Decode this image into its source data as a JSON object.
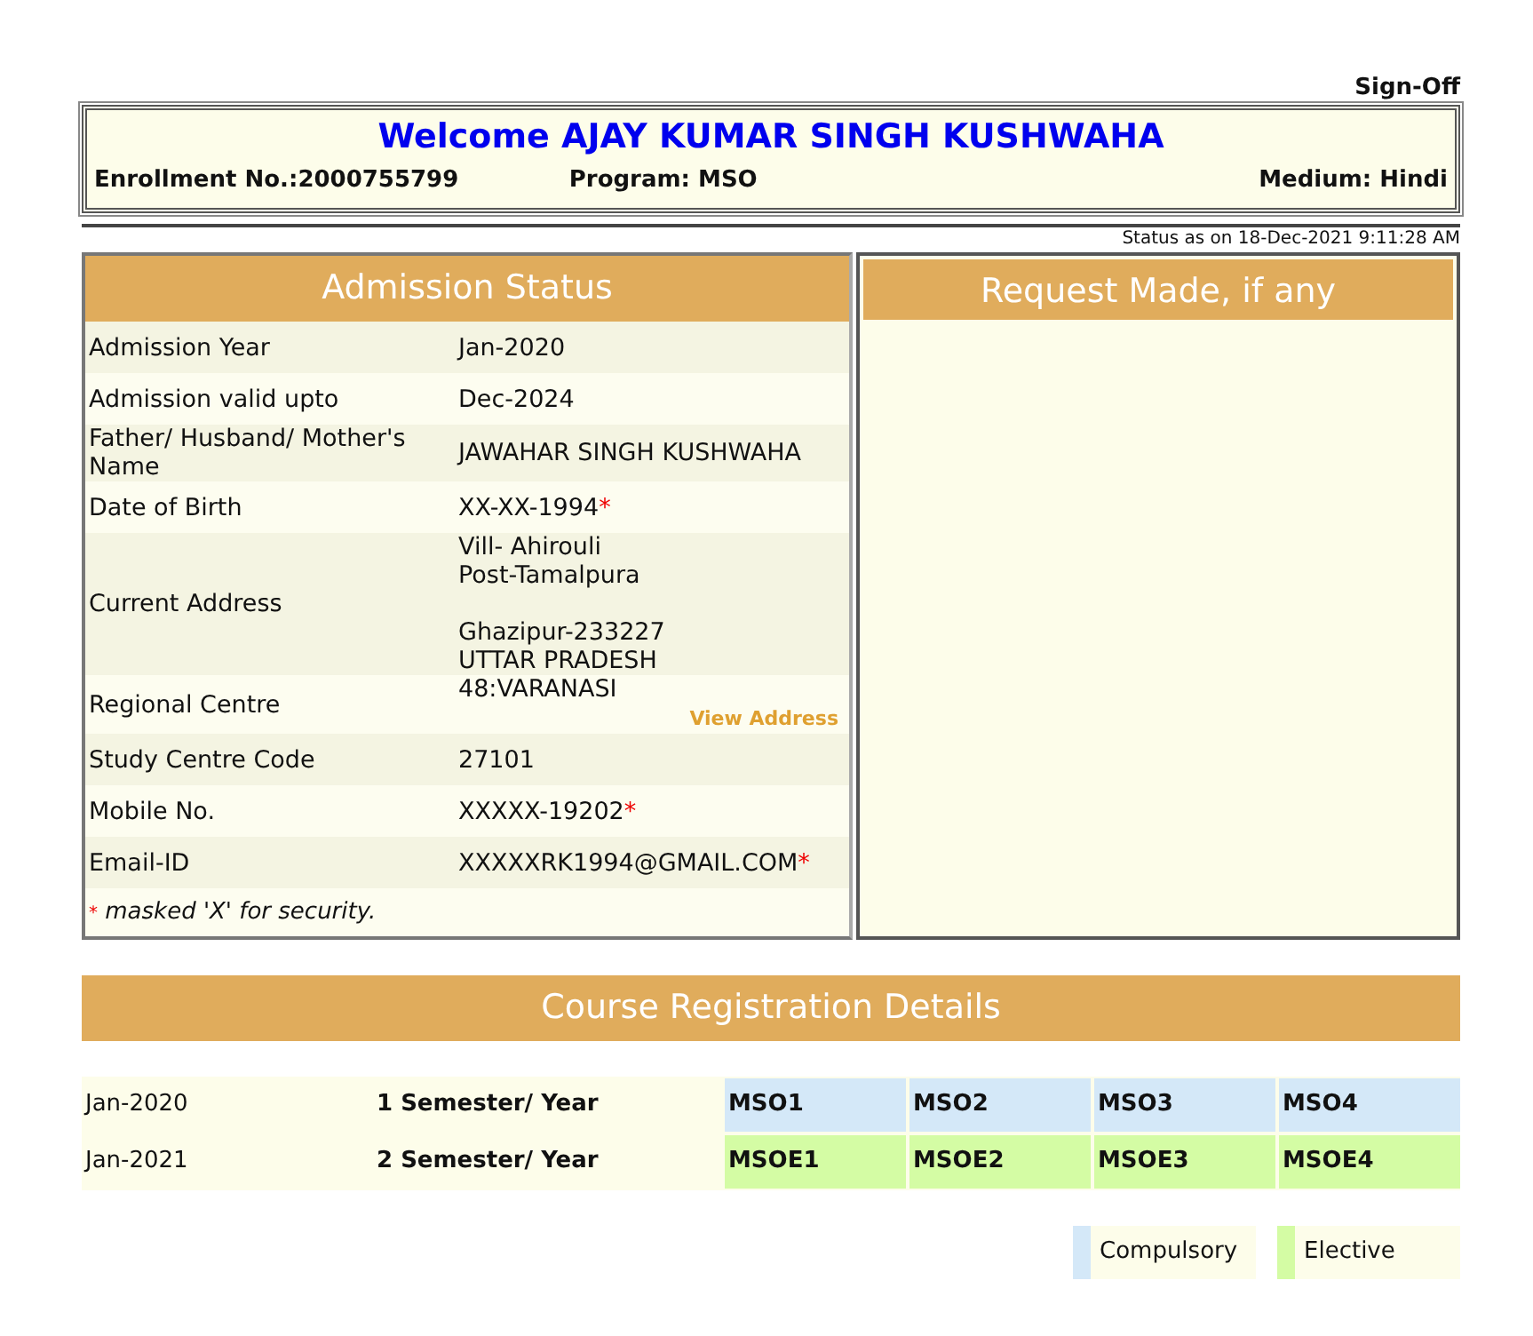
{
  "sign_off": "Sign-Off",
  "header": {
    "welcome": "Welcome AJAY KUMAR SINGH KUSHWAHA",
    "enrollment": "Enrollment No.:2000755799",
    "program": "Program: MSO",
    "medium": "Medium: Hindi"
  },
  "status_time": "Status as on 18-Dec-2021 9:11:28 AM",
  "admission": {
    "title": "Admission Status",
    "rows": [
      {
        "label": "Admission Year",
        "lines": [
          "Jan-2020"
        ],
        "masked": false
      },
      {
        "label": "Admission valid upto",
        "lines": [
          "Dec-2024"
        ],
        "masked": false
      },
      {
        "label": "Father/ Husband/ Mother's Name",
        "lines": [
          "JAWAHAR SINGH KUSHWAHA"
        ],
        "masked": false
      },
      {
        "label": "Date of Birth",
        "lines": [
          "XX-XX-1994"
        ],
        "masked": true
      },
      {
        "label": "Current Address",
        "lines": [
          "Vill- Ahirouli",
          "Post-Tamalpura"
        ],
        "lines_2": [
          "Ghazipur-233227",
          "UTTAR PRADESH"
        ],
        "masked": false
      },
      {
        "label": "Regional Centre",
        "lines": [
          "48:VARANASI"
        ],
        "link": "View Address",
        "masked": false
      },
      {
        "label": "Study Centre Code",
        "lines": [
          "27101"
        ],
        "masked": false
      },
      {
        "label": "Mobile No.",
        "lines": [
          "XXXXX-19202"
        ],
        "masked": true
      },
      {
        "label": "Email-ID",
        "lines": [
          "XXXXXRK1994@GMAIL.COM"
        ],
        "masked": true
      }
    ],
    "note_mark": "*",
    "note": "masked 'X' for security."
  },
  "requests": {
    "title": "Request Made, if any"
  },
  "courses": {
    "title": "Course Registration Details",
    "rows": [
      {
        "session": "Jan-2020",
        "semester": "1 Semester/ Year",
        "courses": [
          {
            "code": "MSO1",
            "kind": "compulsory"
          },
          {
            "code": "MSO2",
            "kind": "compulsory"
          },
          {
            "code": "MSO3",
            "kind": "compulsory"
          },
          {
            "code": "MSO4",
            "kind": "compulsory"
          }
        ]
      },
      {
        "session": "Jan-2021",
        "semester": "2 Semester/ Year",
        "courses": [
          {
            "code": "MSOE1",
            "kind": "elective"
          },
          {
            "code": "MSOE2",
            "kind": "elective"
          },
          {
            "code": "MSOE3",
            "kind": "elective"
          },
          {
            "code": "MSOE4",
            "kind": "elective"
          }
        ]
      }
    ],
    "legend": [
      {
        "label": "Compulsory",
        "kind": "compulsory"
      },
      {
        "label": "Elective",
        "kind": "elective"
      }
    ]
  }
}
